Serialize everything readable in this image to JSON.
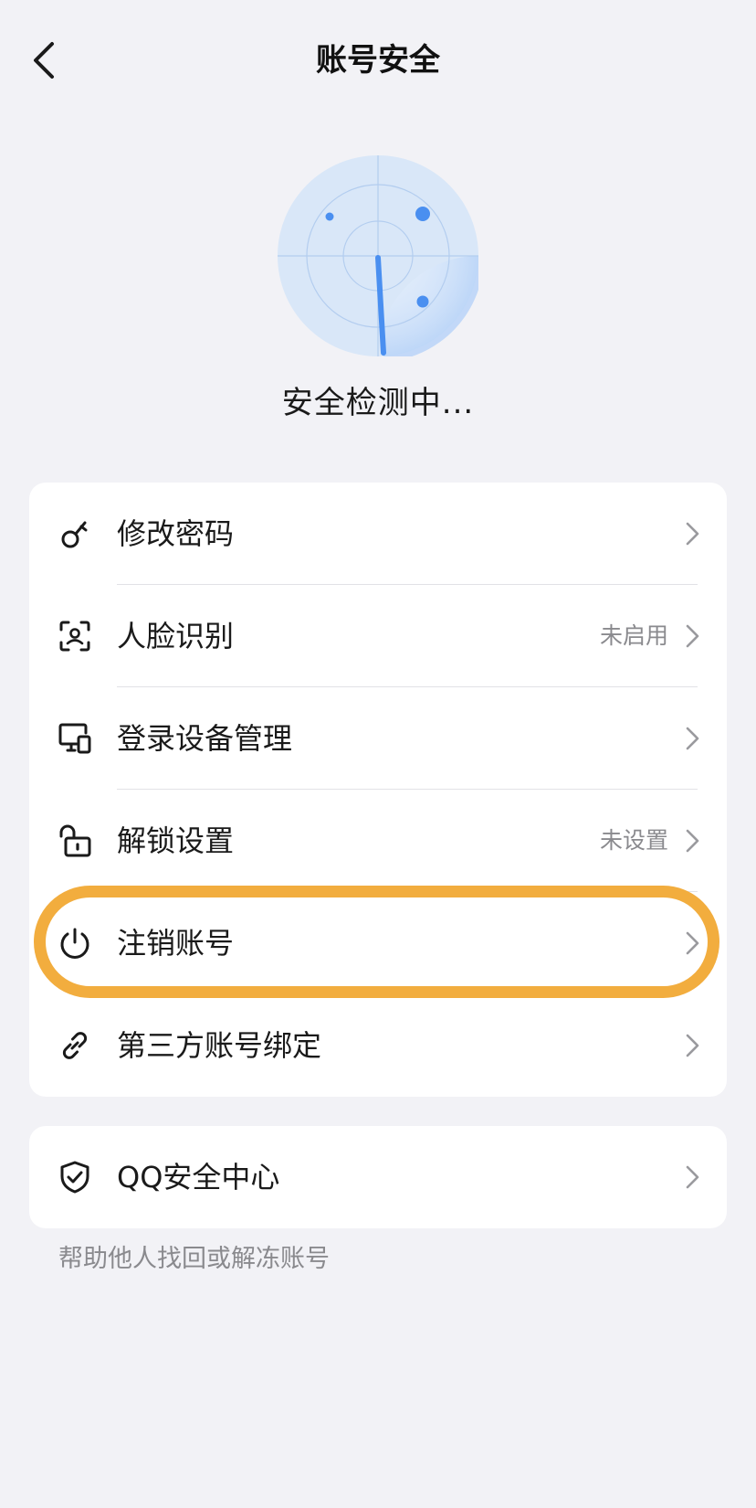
{
  "header": {
    "title": "账号安全",
    "back_icon": "chevron-left-icon"
  },
  "scan": {
    "status": "安全检测中...",
    "radar_color": "#4a8ff0"
  },
  "menu": {
    "items": [
      {
        "label": "修改密码",
        "value": "",
        "icon": "key-icon"
      },
      {
        "label": "人脸识别",
        "value": "未启用",
        "icon": "face-scan-icon"
      },
      {
        "label": "登录设备管理",
        "value": "",
        "icon": "devices-icon"
      },
      {
        "label": "解锁设置",
        "value": "未设置",
        "icon": "unlock-icon"
      },
      {
        "label": "注销账号",
        "value": "",
        "icon": "power-icon"
      },
      {
        "label": "第三方账号绑定",
        "value": "",
        "icon": "link-icon"
      }
    ]
  },
  "security_center": {
    "label": "QQ安全中心",
    "icon": "shield-check-icon"
  },
  "footer": {
    "note": "帮助他人找回或解冻账号"
  },
  "colors": {
    "highlight": "#f2ad3e",
    "background": "#f2f2f6",
    "secondary_text": "#8a8a8e"
  }
}
